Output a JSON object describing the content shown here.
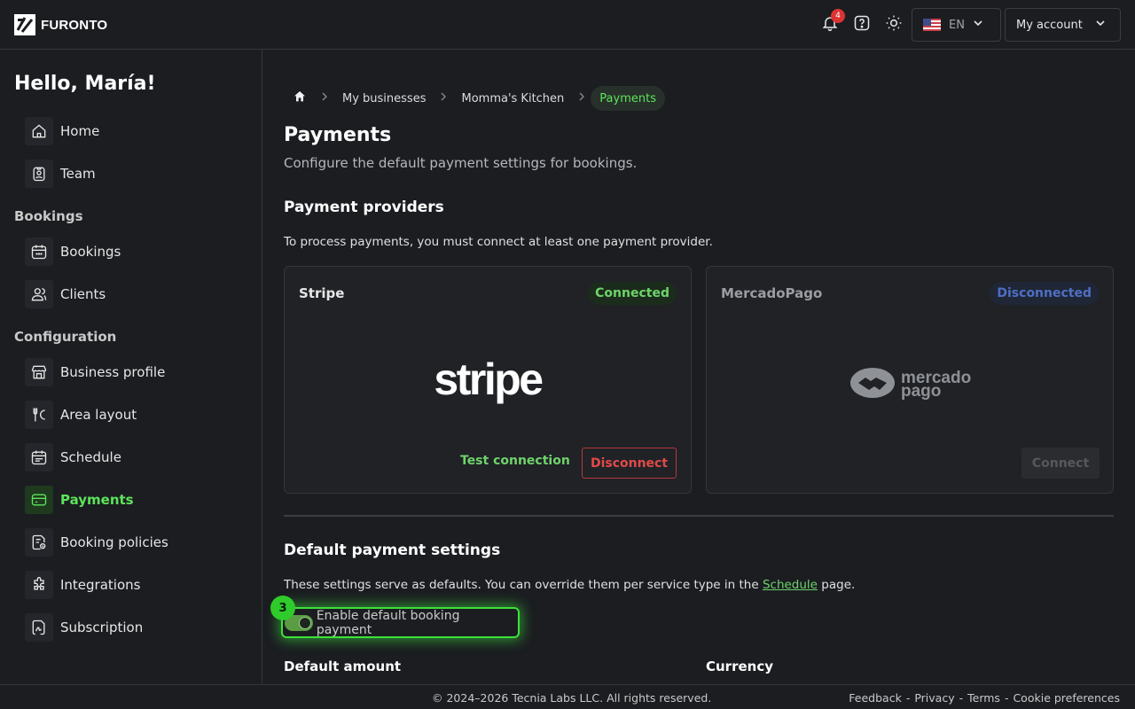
{
  "brand": {
    "name": "FURONTO"
  },
  "header": {
    "notification_count": "4",
    "language": "EN",
    "account_label": "My account"
  },
  "sidebar": {
    "greeting": "Hello, María!",
    "items_top": [
      {
        "label": "Home",
        "icon": "home-icon"
      },
      {
        "label": "Team",
        "icon": "badge-icon"
      }
    ],
    "section_bookings": "Bookings",
    "items_bookings": [
      {
        "label": "Bookings",
        "icon": "calendar-icon"
      },
      {
        "label": "Clients",
        "icon": "users-icon"
      }
    ],
    "section_configuration": "Configuration",
    "items_configuration": [
      {
        "label": "Business profile",
        "icon": "storefront-icon"
      },
      {
        "label": "Area layout",
        "icon": "utensils-icon"
      },
      {
        "label": "Schedule",
        "icon": "schedule-icon"
      },
      {
        "label": "Payments",
        "icon": "credit-card-icon",
        "active": true
      },
      {
        "label": "Booking policies",
        "icon": "policy-icon"
      },
      {
        "label": "Integrations",
        "icon": "puzzle-icon"
      },
      {
        "label": "Subscription",
        "icon": "signature-icon"
      }
    ]
  },
  "breadcrumb": {
    "items": [
      "My businesses",
      "Momma's Kitchen",
      "Payments"
    ]
  },
  "page": {
    "title": "Payments",
    "subtitle": "Configure the default payment settings for bookings."
  },
  "providers": {
    "heading": "Payment providers",
    "description": "To process payments, you must connect at least one payment provider.",
    "stripe": {
      "name": "Stripe",
      "status": "Connected",
      "logo_text": "stripe",
      "test_label": "Test connection",
      "disconnect_label": "Disconnect"
    },
    "mercadopago": {
      "name": "MercadoPago",
      "status": "Disconnected",
      "logo_line1": "mercado",
      "logo_line2": "pago",
      "connect_label": "Connect"
    }
  },
  "defaults": {
    "heading": "Default payment settings",
    "description_before": "These settings serve as defaults. You can override them per service type in the ",
    "description_link": "Schedule",
    "description_after": " page.",
    "toggle_label": "Enable default booking payment",
    "toggle_on": true,
    "step_number": "3",
    "amount_label": "Default amount",
    "currency_label": "Currency"
  },
  "footer": {
    "copyright": "© 2024–2026 Tecnia Labs LLC. All rights reserved.",
    "links": [
      "Feedback",
      "Privacy",
      "Terms",
      "Cookie preferences"
    ],
    "separator": "-"
  },
  "colors": {
    "accent": "#5de35a",
    "danger": "#e04a4a",
    "info": "#4f6fc4",
    "background": "#1b1d21"
  }
}
